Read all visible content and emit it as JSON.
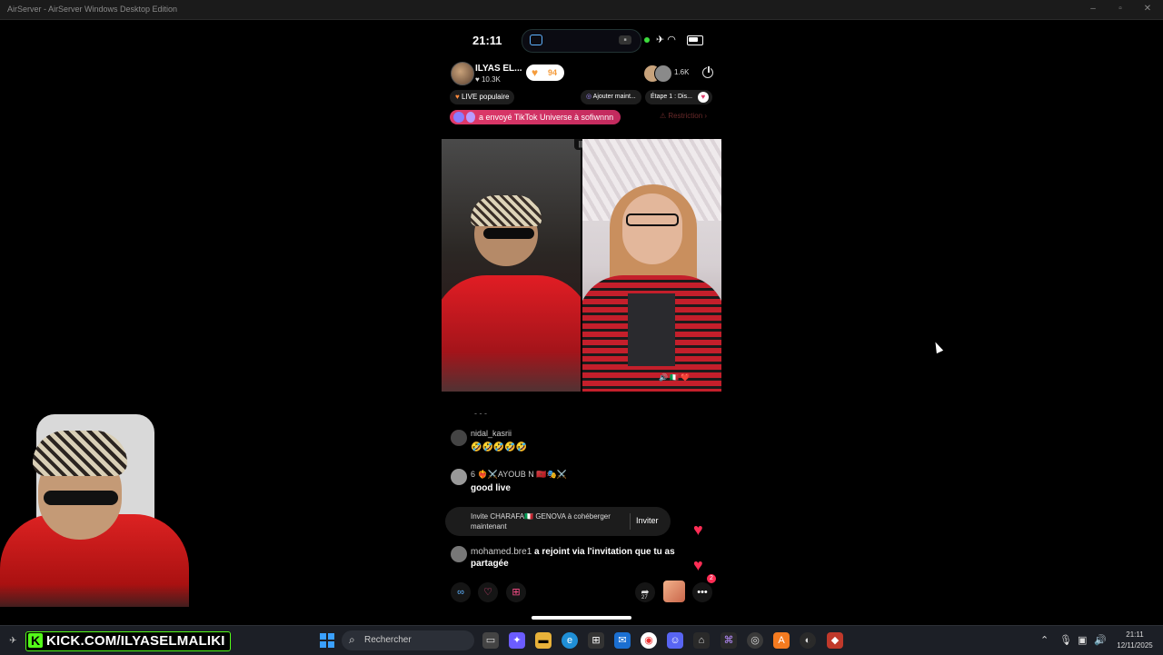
{
  "window": {
    "title": "AirServer - AirServer Windows Desktop Edition"
  },
  "phone": {
    "status_time": "21:11",
    "host": {
      "name": "ILYAS EL...",
      "likes": "10.3K",
      "follow_count": "94"
    },
    "viewer_count": "1.6K",
    "pills": {
      "live_popular": "LIVE populaire",
      "add_now": "Ajouter maint...",
      "step": "Étape 1 : Dis..."
    },
    "gift_banner": "a envoyé TikTok Universe à sofiwnnn",
    "restriction": "Restriction",
    "comments": [
      {
        "user": "nidal_kasrii",
        "message": "🤣🤣🤣🤣🤣"
      },
      {
        "user": "6 ❤️‍🔥⚔️AYOUB N 🇲🇦🎭⚔️",
        "message": "good live"
      }
    ],
    "invite": {
      "text": "Invite CHARAFA🇮🇹 GENOVA à cohéberger maintenant",
      "button": "Inviter"
    },
    "join_message": {
      "user": "mohamed.bre1",
      "text": "a rejoint via l'invitation que tu as partagée"
    },
    "share_count": "27",
    "gift_badge": "2"
  },
  "webcam_overlay": {
    "kick_url": "KICK.COM/ILYASELMALIKI"
  },
  "taskbar": {
    "search_placeholder": "Rechercher",
    "time": "21:11",
    "date": "12/11/2025"
  },
  "colors": {
    "accent_pink": "#e03a6a",
    "kick_green": "#53fc18",
    "heart_red": "#ff2d55"
  }
}
